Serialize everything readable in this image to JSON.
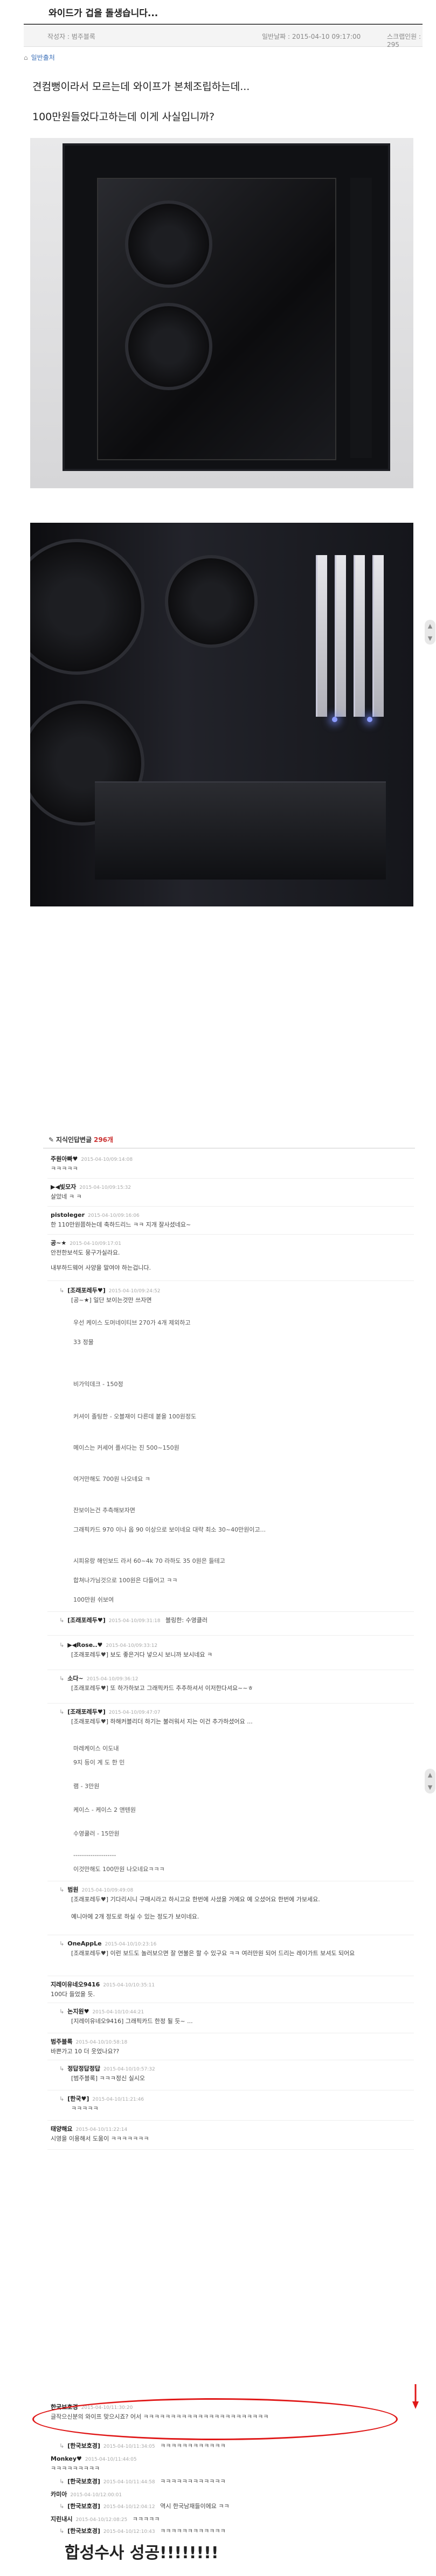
{
  "post": {
    "title": "와이드가 겁을 돌생습니다...",
    "author_label": "작성자 : 범주블록",
    "date_label": "일반날짜 : 2015-04-10 09:17:00",
    "views_label": "스크랩인원 : 295",
    "source_label": "일반출처",
    "body": [
      "견컴뻥이라서 모르는데 와이프가 본체조립하는데...",
      "100만원들었다고하는데 이게 사실입니까?"
    ]
  },
  "comments": {
    "header": "지식인답변글",
    "count": "296개",
    "items": [
      {
        "nick": "주원아빠♥",
        "date": "2015-04-10/09:14:08",
        "text": "ㅋㅋㅋㅋㅋ"
      },
      {
        "nick": "▶◀빛모자",
        "date": "2015-04-10/09:15:32",
        "text": "살았네 ㅋ ㅋ"
      },
      {
        "nick": "pistoleger",
        "date": "2015-04-10/09:16:06",
        "text": "한 110만원쯤하는데 축하드리느 ㅋㅋ 지개 잘사셨네요~"
      },
      {
        "nick": "공~★",
        "date": "2015-04-10/09:17:01",
        "text": "안전한보석도 뭉구가실라요."
      },
      {
        "text": "내부하드웨어 사양을 말여야 하는겁니다."
      },
      {
        "nick": "[조래포레두♥]",
        "date": "2015-04-10/09:24:52",
        "sub": "[공~★] 일단 보이는것만 쓰자면",
        "reply": true
      }
    ],
    "reply_lines": [
      "우선 케이스 도머네이티브 270가 4개 제외하고",
      "33 정물",
      "비가익데크 - 150정",
      "커셔이 졸팅한 - 오블재이 다른데 붙을 100원정도",
      "메이스는 커세어 플서다는 진 500~150원",
      "여거만해도 700원 나오네요 ㅋ",
      "잔보이는건 추측해보자면",
      "그래픽카드 970 이나 옵 90 이상으로 보이네요 대략 최소 30~40만원이고...",
      "시피유랑 해인보드 라서 60~4k 70 라하도 35 0원은 들테고",
      "합쳐나가님것으로 100원은 다들어고 ㅋㅋ",
      "100만원 쉬보여"
    ],
    "replies": [
      {
        "nick": "[조래포레두♥]",
        "date": "2015-04-10/09:31:18",
        "text": "블링한: 수영클러"
      },
      {
        "nick": "▶◀Rose..♥",
        "date": "2015-04-10/09:33:12",
        "text": "[조래포레두♥] 보도 좋은거다 넣으시 보니까 보시네요 ㅋ"
      },
      {
        "nick": "소다~",
        "date": "2015-04-10/09:36:12",
        "text": "[조래포레두♥] 또 하가하보고 그래픽카드 추추하셔서 이저한다셔요~~ㅎ"
      },
      {
        "nick": "[조래포레두♥]",
        "date": "2015-04-10/09:47:07",
        "text": "[조래포레두♥] 하해커블리더 하기는 불러워서 지는 이건 추가하셨어요 ..."
      }
    ],
    "spec_lines": [
      "마레케이스 이도내",
      "9지 등이 계 도 한 민",
      "램 - 3만원",
      "케이스 - 케이스 2 앤텐원",
      "수영쿨러 - 15만원",
      "--------------------",
      "이것만해도 100만원 나오네요ㅋㅋㅋ"
    ],
    "later": [
      {
        "nick": "범원",
        "date": "2015-04-10/09:49:08",
        "text": "[조래포레두♥] 기다리시니 구매시라고 하시고요 한번에 사셨을 거예요 예 오셨어요 한번에 가보세요."
      },
      {
        "text": "예니아에 2개 정도로 하실 수 있는 정도가 보이네요."
      },
      {
        "nick": "OneAppLe",
        "date": "2015-04-10/10:23:16",
        "text": "[조래포레두♥] 이런 보드도 놀러보으면 잘 연불은 할 수 있구요 ㅋㅋ 여러만원 되어 드리는 레이가트 보셔도 되어요"
      },
      {
        "nick": "지레이유네오9416",
        "date": "2015-04-10/10:35:11",
        "text": "100다 들었을 듯."
      },
      {
        "nick": "논지원♥",
        "date": "2015-04-10/10:44:21",
        "text": "[지레이유네오9416] 그래픽카드 한정 될 듯~ ..."
      },
      {
        "nick": "범주블록",
        "date": "2015-04-10/10:58:18",
        "text": "바쁜가고 10 더 웃었나요??"
      },
      {
        "nick": "정답정답정답",
        "date": "2015-04-10/10:57:32",
        "text": "[범주블록] ㅋㅋㅋ정신 실시오"
      },
      {
        "nick": "[한국♥]",
        "date": "2015-04-10/11:21:46",
        "text": "ㅋㅋㅋㅋㅋ"
      },
      {
        "nick": "태양해요",
        "date": "2015-04-10/11:22:14",
        "text": "시영을 이용해서 도움이 ㅋㅋㅋㅋㅋㅋㅋ"
      },
      {
        "nick": "한국보호경",
        "date": "2015-04-10/11:30:20",
        "text": "글작으신분의 와이프 맞으시죠? 어서 ㅋㅋㅋㅋㅋㅋㅋㅋㅋㅋㅋㅋㅋㅋㅋㅋㅋㅋㅋㅋㅋㅋㅋ"
      },
      {
        "nick": "[한국보호경]",
        "date": "2015-04-10/11:34:05",
        "text": "ㅋㅋㅋㅋㅋㅋㅋㅋㅋㅋㅋㅋ",
        "reply": true
      },
      {
        "nick": "Monkey♥",
        "date": "2015-04-10/11:44:05",
        "text": "ㅋㅋㅋㅋㅋㅋㅋㅋㅋ"
      },
      {
        "nick": "[한국보호경]",
        "date": "2015-04-10/11:44:58",
        "text": "ㅋㅋㅋㅋㅋㅋㅋㅋㅋㅋㅋㅋ",
        "reply": true
      },
      {
        "nick": "카미아",
        "date": "2015-04-10/12:00:01",
        "text": ""
      },
      {
        "nick": "[한국보호경]",
        "date": "2015-04-10/12:04:12",
        "text": "역시 한국남재들이에요 ㅋㅋ",
        "reply": true
      },
      {
        "nick": "지린내시",
        "date": "2015-04-10/12:08:25",
        "text": "ㅋㅋㅋㅋㅋ"
      },
      {
        "nick": "[한국보호경]",
        "date": "2015-04-10/12:10:43",
        "text": "ㅋㅋㅋㅋㅋㅋㅋㅋㅋㅋㅋㅋ",
        "reply": true
      }
    ]
  },
  "footer": {
    "success_text": "합성수사 성공!!!!!!!!"
  }
}
